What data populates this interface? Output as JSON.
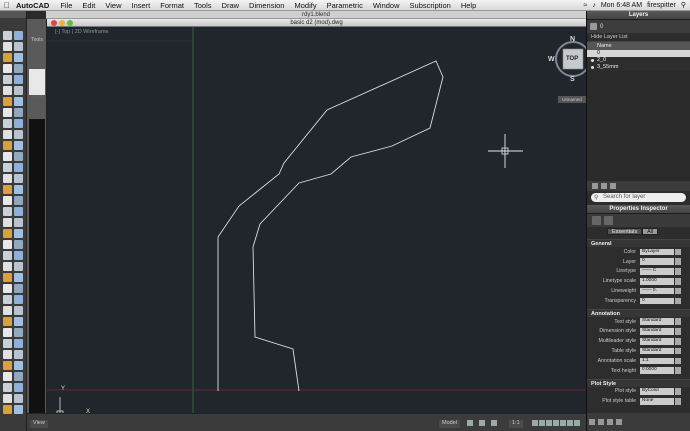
{
  "menubar": {
    "app_name": "AutoCAD",
    "items": [
      "File",
      "Edit",
      "View",
      "Insert",
      "Format",
      "Tools",
      "Draw",
      "Dimension",
      "Modify",
      "Parametric",
      "Window",
      "Subscription",
      "Help"
    ],
    "clock": "Mon 6:48 AM",
    "user": "firespitter"
  },
  "background_window": {
    "title": "rdy1.blend"
  },
  "document": {
    "title": "basic d2 (mod).dwg",
    "view_label": "[-] Top | 2D Wireframe",
    "viewcube_face": "TOP",
    "compass": {
      "n": "N",
      "s": "S",
      "e": "E",
      "w": "W"
    },
    "unnamed_badge": "Unnamed",
    "axis_y": "Y",
    "axis_x": "X"
  },
  "subpanel": {
    "label": "Tools",
    "label2": "Draft"
  },
  "bottombar": {
    "tab1": "Model",
    "tab2": "View",
    "scale": "1:1"
  },
  "layers": {
    "panel_title": "Layers",
    "current_layer": "0",
    "hide_list": "Hide Layer List",
    "column_name": "Name",
    "rows": [
      "0",
      "2_0",
      "3_55mm"
    ],
    "search_placeholder": "Search for layer"
  },
  "properties": {
    "panel_title": "Properties Inspector",
    "tabs": [
      "Essentials",
      "All"
    ],
    "sections": {
      "general": "General",
      "annotation": "Annotation",
      "plot": "Plot Style"
    },
    "general": [
      {
        "key": "Color",
        "val": "ByLayer"
      },
      {
        "key": "Layer",
        "val": "0"
      },
      {
        "key": "Linetype",
        "val": "—— C"
      },
      {
        "key": "Linetype scale",
        "val": "1.0000"
      },
      {
        "key": "Lineweight",
        "val": "—— 0."
      },
      {
        "key": "Transparency",
        "val": "0"
      }
    ],
    "annotation": [
      {
        "key": "Text style",
        "val": "Standard"
      },
      {
        "key": "Dimension style",
        "val": "Standard"
      },
      {
        "key": "Multileader style",
        "val": "Standard"
      },
      {
        "key": "Table style",
        "val": "Standard"
      },
      {
        "key": "Annotation scale",
        "val": "1:1"
      },
      {
        "key": "Text height",
        "val": "0.0000"
      }
    ],
    "plot": [
      {
        "key": "Plot style",
        "val": "ByColor"
      },
      {
        "key": "Plot style table",
        "val": "None"
      }
    ]
  }
}
